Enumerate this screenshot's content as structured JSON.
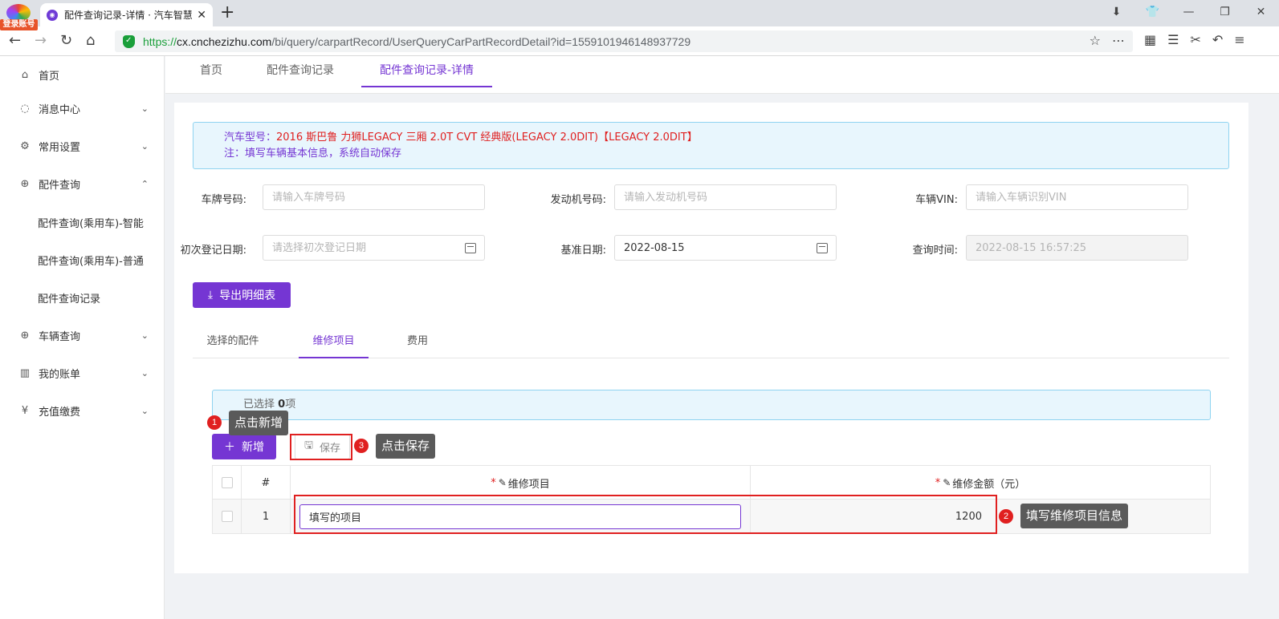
{
  "browser": {
    "login_badge": "登录账号",
    "tab_title": "配件查询记录-详情 · 汽车智慧",
    "url_scheme": "https://",
    "url_host": "cx.cnchezizhu.com",
    "url_path": "/bi/query/carpartRecord/UserQueryCarPartRecordDetail?id=1559101946148937729"
  },
  "sidebar": {
    "items": [
      {
        "label": "首页",
        "icon": "home-icon"
      },
      {
        "label": "消息中心",
        "icon": "message-icon"
      },
      {
        "label": "常用设置",
        "icon": "settings-icon"
      },
      {
        "label": "配件查询",
        "icon": "zoom-search-icon"
      },
      {
        "label": "车辆查询",
        "icon": "zoom-search-icon"
      },
      {
        "label": "我的账单",
        "icon": "bar-chart-icon"
      },
      {
        "label": "充值缴费",
        "icon": "yuan-shield-icon"
      }
    ],
    "sub_items": [
      {
        "label": "配件查询(乘用车)-智能"
      },
      {
        "label": "配件查询(乘用车)-普通"
      },
      {
        "label": "配件查询记录"
      }
    ]
  },
  "page_tabs": [
    {
      "label": "首页"
    },
    {
      "label": "配件查询记录"
    },
    {
      "label": "配件查询记录-详情"
    }
  ],
  "info": {
    "model_label": "汽车型号：",
    "model_value": "2016 斯巴鲁 力狮LEGACY 三厢 2.0T CVT 经典版(LEGACY 2.0DIT)【LEGACY 2.0DIT】",
    "note": "注：填写车辆基本信息，系统自动保存"
  },
  "form": {
    "plate_label": "车牌号码:",
    "plate_placeholder": "请输入车牌号码",
    "engine_label": "发动机号码:",
    "engine_placeholder": "请输入发动机号码",
    "vin_label": "车辆VIN:",
    "vin_placeholder": "请输入车辆识别VIN",
    "reg_date_label": "初次登记日期:",
    "reg_date_placeholder": "请选择初次登记日期",
    "base_date_label": "基准日期:",
    "base_date_value": "2022-08-15",
    "query_time_label": "查询时间:",
    "query_time_value": "2022-08-15 16:57:25"
  },
  "export_button": "导出明细表",
  "sub_tabs": [
    {
      "label": "选择的配件"
    },
    {
      "label": "维修项目"
    },
    {
      "label": "费用"
    }
  ],
  "selection": {
    "prefix": "已选择 ",
    "count": "0",
    "suffix": "项"
  },
  "buttons": {
    "add": "新增",
    "save": "保存"
  },
  "table": {
    "headers": {
      "index": "#",
      "item": "维修项目",
      "amount": "维修金额（元）",
      "required_mark": "*"
    },
    "rows": [
      {
        "index": "1",
        "item": "填写的项目",
        "amount": "1200"
      }
    ]
  },
  "annotations": [
    {
      "num": "1",
      "text": "点击新增"
    },
    {
      "num": "2",
      "text": "填写维修项目信息"
    },
    {
      "num": "3",
      "text": "点击保存"
    }
  ],
  "colors": {
    "accent": "#7536d3",
    "annotation_red": "#e02020",
    "info_bg": "#e8f6fd"
  }
}
